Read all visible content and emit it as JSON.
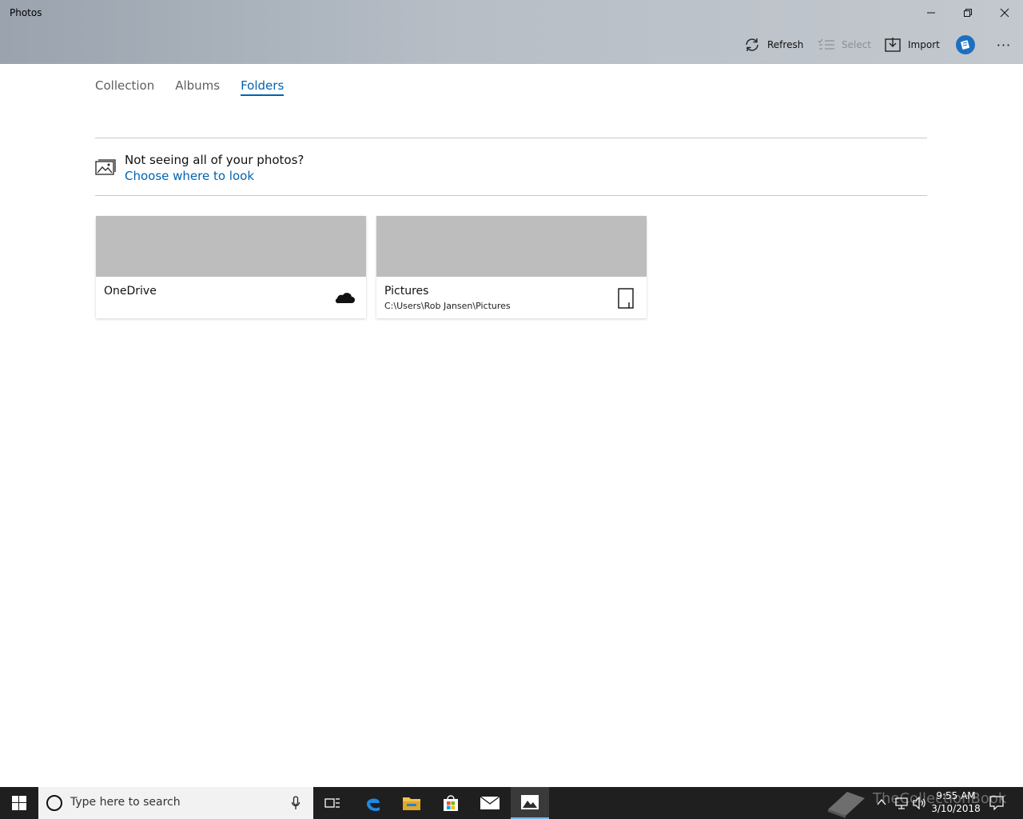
{
  "window": {
    "title": "Photos",
    "controls": [
      "minimize",
      "restore",
      "close"
    ]
  },
  "commandbar": {
    "refresh_label": "Refresh",
    "select_label": "Select",
    "import_label": "Import",
    "more_label": "···"
  },
  "tabs": [
    {
      "label": "Collection",
      "active": false
    },
    {
      "label": "Albums",
      "active": false
    },
    {
      "label": "Folders",
      "active": true
    }
  ],
  "info": {
    "question": "Not seeing all of your photos?",
    "link": "Choose where to look"
  },
  "folders": [
    {
      "name": "OneDrive",
      "path": "",
      "icon": "cloud-icon"
    },
    {
      "name": "Pictures",
      "path": "C:\\Users\\Rob Jansen\\Pictures",
      "icon": "folder-device-icon"
    }
  ],
  "taskbar": {
    "search_placeholder": "Type here to search",
    "watermark": "TheCollectionBook",
    "time": "9:55 AM",
    "date": "3/10/2018",
    "apps": [
      "task-view",
      "edge",
      "file-explorer",
      "store",
      "mail",
      "photos"
    ],
    "active_app": "photos"
  },
  "colors": {
    "accent": "#0063b1",
    "titlebar": "#b7bec6",
    "taskbar": "#1f1f1f",
    "thumb": "#bdbdbd"
  }
}
